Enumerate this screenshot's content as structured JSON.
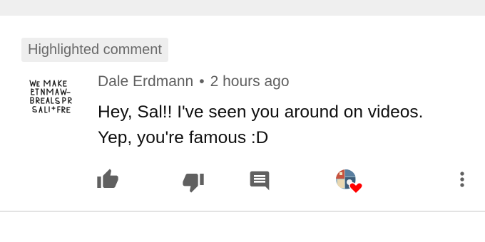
{
  "highlight": {
    "label": "Highlighted comment"
  },
  "comment": {
    "author": "Dale Erdmann",
    "separator": "•",
    "time": "2 hours ago",
    "text_lines": [
      "Hey, Sal!! I've seen you around on videos.",
      "Yep, you're famous :D"
    ],
    "avatar_lettering": "We Make Beautiful Days for Sale Free"
  },
  "actions": {
    "icons": [
      "thumbs-up-icon",
      "thumbs-down-icon",
      "reply-icon",
      "creator-heart-icon",
      "more-vertical-icon"
    ]
  },
  "colors": {
    "icon": "#606060",
    "text": "#0f0f0f",
    "meta": "#606060",
    "chip_bg": "#eeeeee",
    "heart": "#ff0000"
  }
}
